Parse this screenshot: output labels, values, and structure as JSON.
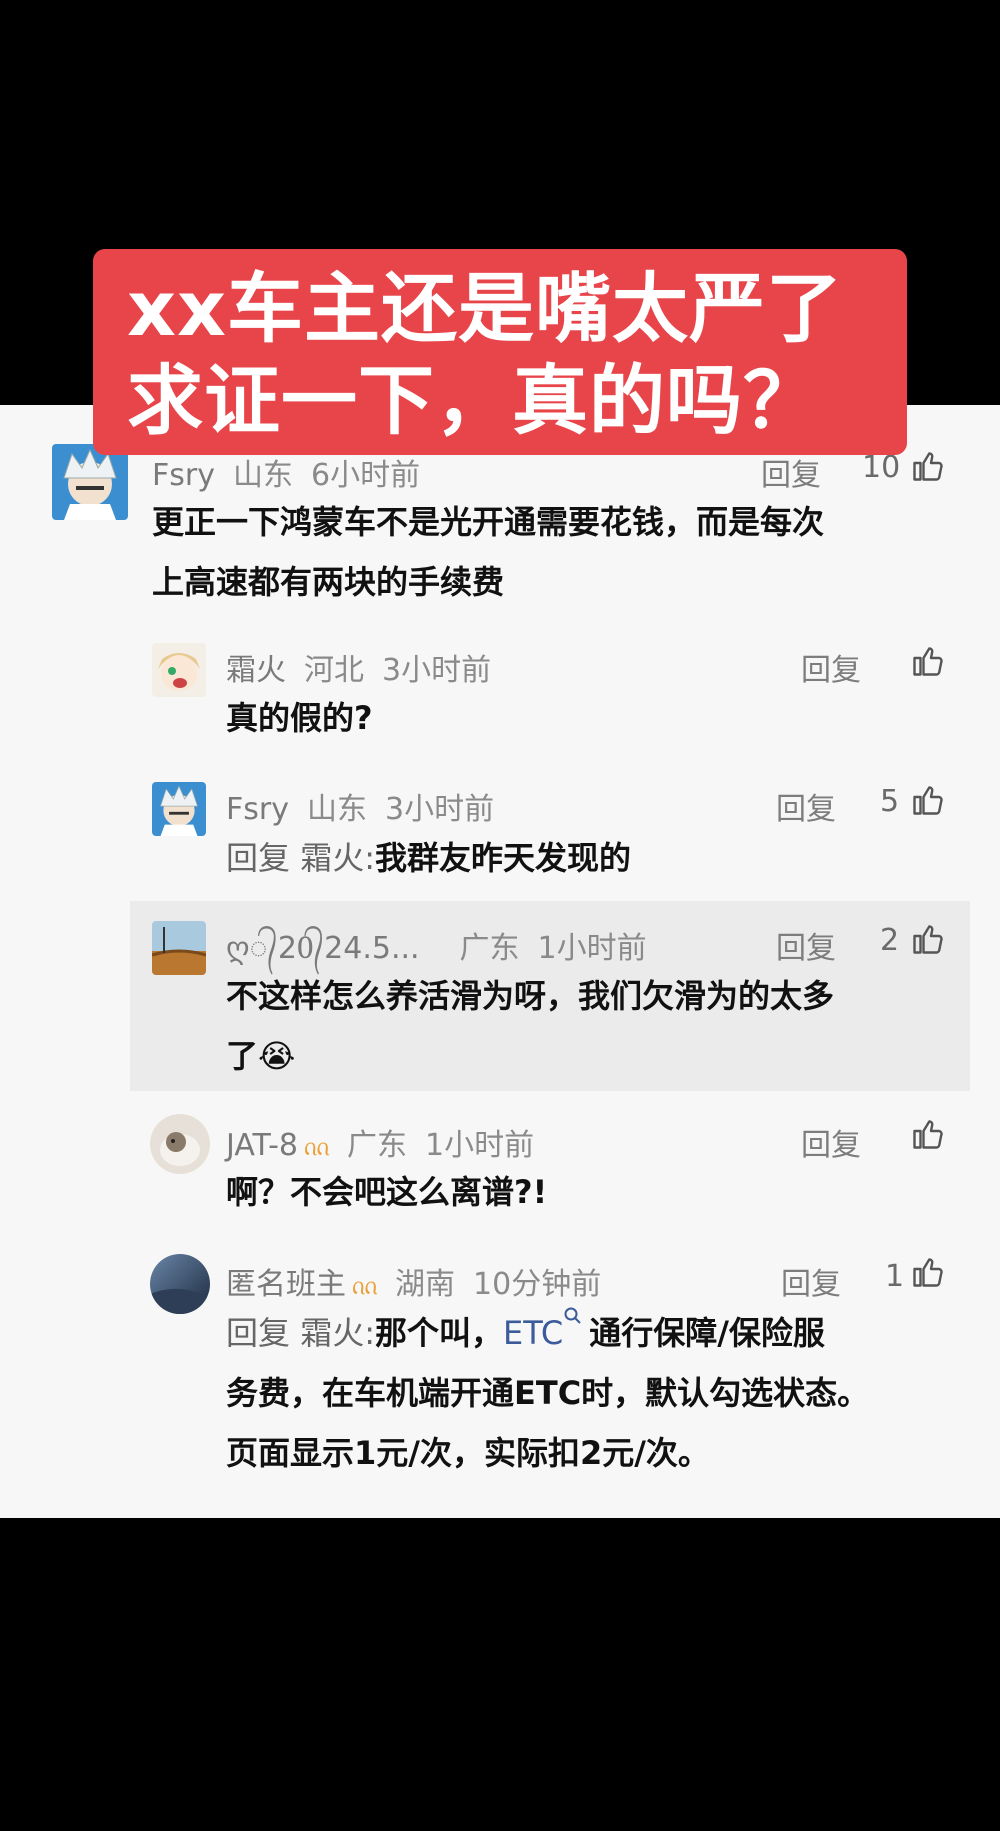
{
  "banner": {
    "line1": "xx车主还是嘴太严了",
    "line2": "求证一下，真的吗？"
  },
  "ui": {
    "reply_label": "回复",
    "reply_prefix": "回复 "
  },
  "comments": [
    {
      "user": "Fsry",
      "location": "山东",
      "time": "6小时前",
      "likes": "10",
      "text_line1": "更正一下鸿蒙车不是光开通需要花钱，而是每次",
      "text_line2": "上高速都有两块的手续费"
    },
    {
      "user": "霜火",
      "location": "河北",
      "time": "3小时前",
      "likes": "",
      "text_line1": "真的假的?"
    },
    {
      "user": "Fsry",
      "location": "山东",
      "time": "3小时前",
      "likes": "5",
      "reply_to": "霜火:",
      "text_line1": "我群友昨天发现的"
    },
    {
      "user": "ღ᭄20᭄24.5...",
      "location": "广东",
      "time": "1小时前",
      "likes": "2",
      "text_line1": "不这样怎么养活滑为呀，我们欠滑为的太多",
      "text_line2": "了😭"
    },
    {
      "user": "JAT-8",
      "location": "广东",
      "time": "1小时前",
      "likes": "",
      "badge": "ᦶ",
      "text_line1": "啊？不会吧这么离谱?!"
    },
    {
      "user": "匿名班主",
      "location": "湖南",
      "time": "10分钟前",
      "likes": "1",
      "badge": "ᦶ",
      "reply_to": "霜火:",
      "text_a": "那个叫，",
      "etc": "ETC",
      "text_b": "通行保障/保险服",
      "text_line2": "务费，在车机端开通ETC时，默认勾选状态。",
      "text_line3": "页面显示1元/次，实际扣2元/次。"
    }
  ],
  "colors": {
    "banner": "#e8454a",
    "panel": "#f7f7f7",
    "highlight": "#ebebeb"
  }
}
